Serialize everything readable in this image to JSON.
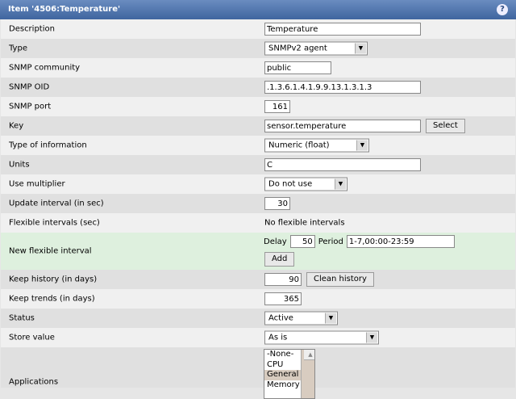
{
  "header": {
    "title": "Item '4506:Temperature'",
    "help_icon": "question-icon"
  },
  "fields": {
    "description": {
      "label": "Description",
      "value": "Temperature"
    },
    "type": {
      "label": "Type",
      "value": "SNMPv2 agent"
    },
    "community": {
      "label": "SNMP community",
      "value": "public"
    },
    "oid": {
      "label": "SNMP OID",
      "value": ".1.3.6.1.4.1.9.9.13.1.3.1.3"
    },
    "port": {
      "label": "SNMP port",
      "value": "161"
    },
    "key": {
      "label": "Key",
      "value": "sensor.temperature",
      "button": "Select"
    },
    "info": {
      "label": "Type of information",
      "value": "Numeric (float)"
    },
    "units": {
      "label": "Units",
      "value": "C"
    },
    "multiplier": {
      "label": "Use multiplier",
      "value": "Do not use"
    },
    "interval": {
      "label": "Update interval (in sec)",
      "value": "30"
    },
    "flex": {
      "label": "Flexible intervals (sec)",
      "value": "No flexible intervals"
    },
    "newflex": {
      "label": "New flexible interval",
      "delay_label": "Delay",
      "delay": "50",
      "period_label": "Period",
      "period": "1-7,00:00-23:59",
      "add": "Add"
    },
    "history": {
      "label": "Keep history (in days)",
      "value": "90",
      "button": "Clean history"
    },
    "trends": {
      "label": "Keep trends (in days)",
      "value": "365"
    },
    "status": {
      "label": "Status",
      "value": "Active"
    },
    "store": {
      "label": "Store value",
      "value": "As is"
    },
    "applications": {
      "label": "Applications",
      "options": [
        "-None-",
        "CPU",
        "General",
        "Memory"
      ],
      "selected": "General"
    }
  }
}
